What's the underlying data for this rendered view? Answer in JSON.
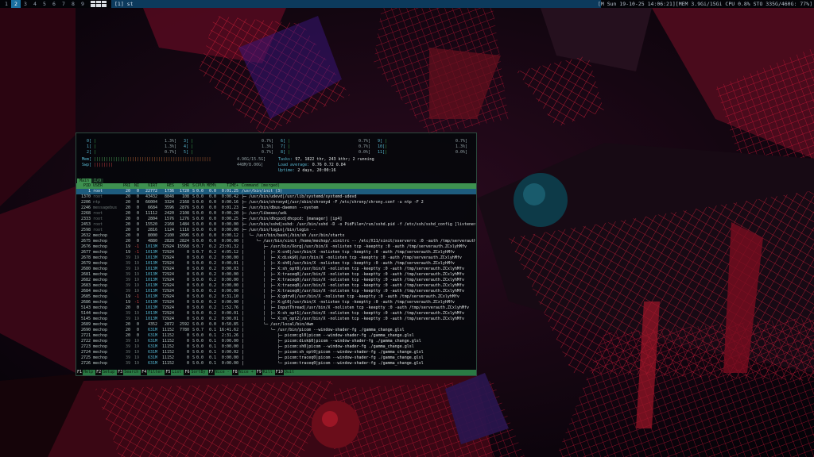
{
  "topbar": {
    "tags": [
      "1",
      "2",
      "3",
      "4",
      "5",
      "6",
      "7",
      "8",
      "9"
    ],
    "selected_tag": "2",
    "window_title": "[1] st",
    "status": "[M Sun 19-10-25 14:06:21][MEM 3.9Gi/15Gi CPU 0.8% STO 335G/460G: 77%]"
  },
  "htop": {
    "cpu_meters": [
      {
        "label": "0[",
        "value": "1.3%]"
      },
      {
        "label": "3[",
        "value": "0.7%]"
      },
      {
        "label": "6[",
        "value": "0.7%]"
      },
      {
        "label": "9[",
        "value": "0.7%]"
      },
      {
        "label": "1[",
        "value": "1.3%]"
      },
      {
        "label": "4[",
        "value": "1.3%]"
      },
      {
        "label": "7[",
        "value": "0.7%]"
      },
      {
        "label": "10[",
        "value": "1.3%]"
      },
      {
        "label": "2[",
        "value": "0.7%]"
      },
      {
        "label": "5[",
        "value": "0.7%]"
      },
      {
        "label": "8[",
        "value": "0.0%]"
      },
      {
        "label": "11[",
        "value": "0.0%]"
      }
    ],
    "mem": {
      "label": "Mem[",
      "value": "4.96G/15.5G]"
    },
    "swp": {
      "label": "Swp[",
      "value": "448M/8.00G]"
    },
    "tasks": {
      "prefix": "Tasks: ",
      "value": "97, 1822 thr, 243 kthr; 2 running"
    },
    "load": {
      "prefix": "Load average: ",
      "value": "0.76 0.72 0.84"
    },
    "uptime": {
      "prefix": "Uptime: ",
      "value": "2 days, 20:00:16"
    },
    "tabs": [
      "Main",
      "I/O"
    ],
    "columns": [
      "PID",
      "USER",
      "PRI",
      "NI",
      "VIRT",
      "RES",
      "SHR",
      "S",
      "CPU%",
      "MEM%",
      "TIME+",
      "Command (merged)"
    ],
    "processes": [
      [
        "1",
        "root",
        "20",
        "0",
        "22772",
        "1736",
        "1720",
        "S",
        "0.0",
        "0.0",
        "0:01.25",
        "/usr/bin/init (3)"
      ],
      [
        "1370",
        "root",
        "20",
        "0",
        "43432",
        "8848",
        "108",
        "S",
        "0.0",
        "0.0",
        "0:00.42",
        "├─ /usr/bin/udevd|/usr/lib/systemd/systemd-udevd"
      ],
      [
        "2206",
        "ntp",
        "20",
        "0",
        "66004",
        "3324",
        "2168",
        "S",
        "0.0",
        "0.0",
        "0:00.16",
        "├─ /usr/bin/chronyd|/usr/sbin/chronyd -F /etc/chrony/chrony.conf -u ntp -F 2"
      ],
      [
        "2246",
        "messagebus",
        "20",
        "0",
        "6684",
        "3596",
        "2876",
        "S",
        "0.0",
        "0.0",
        "0:01.23",
        "├─ /usr/bin/dbus-daemon --system"
      ],
      [
        "2268",
        "root",
        "20",
        "0",
        "11112",
        "2420",
        "2108",
        "S",
        "0.0",
        "0.0",
        "0:00.20",
        "├─ /usr/libexec/udi"
      ],
      [
        "2333",
        "root",
        "20",
        "0",
        "2804",
        "1576",
        "1276",
        "S",
        "0.0",
        "0.0",
        "0:00.25",
        "├─ /usr/bin/dhcpcd|dhcpcd: [manager] [ip4]"
      ],
      [
        "2453",
        "root",
        "20",
        "0",
        "15520",
        "2168",
        "1484",
        "S",
        "0.0",
        "0.0",
        "0:00.00",
        "├─ /usr/bin/sshd|sshd: /usr/bin/sshd -D -o PidFile=/run/sshd.pid -f /etc/ssh/sshd_config [listener]"
      ],
      [
        "2598",
        "root",
        "20",
        "0",
        "2816",
        "1124",
        "1116",
        "S",
        "0.0",
        "0.0",
        "0:00.00",
        "├─ /usr/bin/login|/bin/login --"
      ],
      [
        "2632",
        "mechop",
        "20",
        "0",
        "8000",
        "2100",
        "2096",
        "S",
        "0.0",
        "0.0",
        "0:00.12",
        "│  └─ /usr/bin/bash|/bin/sh /usr/bin/startx"
      ],
      [
        "2675",
        "mechop",
        "20",
        "0",
        "4880",
        "2828",
        "2824",
        "S",
        "0.0",
        "0.0",
        "0:00.00",
        "│     └─ /usr/bin/xinit /home/mechop/.xinitrc -- /etc/X11/xinit/xserverrc :0 -auth /tmp/serverauth"
      ],
      [
        "2676",
        "mechop",
        "19",
        "-1",
        "1013M",
        "72924",
        "15568",
        "S",
        "0.7",
        "0.2",
        "23:01.32",
        "│        ├─ /usr/bin/Xorg|/usr/bin/X -nolisten tcp -keeptty :0 -auth /tmp/serverauth.ZCxlyhMfv"
      ],
      [
        "2677",
        "mechop",
        "19",
        "-1",
        "1013M",
        "72924",
        "0",
        "S",
        "0.7",
        "0.2",
        "4:05.12",
        "│        │  ├─ X:cn0|/usr/bin/X -nolisten tcp -keeptty :0 -auth /tmp/serverauth.ZCxlyhMfv"
      ],
      [
        "2678",
        "mechop",
        "39",
        "19",
        "1013M",
        "72924",
        "0",
        "S",
        "0.0",
        "0.2",
        "0:00.00",
        "│        │  ├─ X:disk$0|/usr/bin/X -nolisten tcp -keeptty :0 -auth /tmp/serverauth.ZCxlyhMfv"
      ],
      [
        "2679",
        "mechop",
        "39",
        "19",
        "1013M",
        "72924",
        "0",
        "S",
        "0.0",
        "0.2",
        "0:00.01",
        "│        │  ├─ X:sh0|/usr/bin/X -nolisten tcp -keeptty :0 -auth /tmp/serverauth.ZCxlyhMfv"
      ],
      [
        "2680",
        "mechop",
        "39",
        "19",
        "1013M",
        "72924",
        "0",
        "S",
        "0.0",
        "0.2",
        "0:00.03",
        "│        │  ├─ X:sh_opt0|/usr/bin/X -nolisten tcp -keeptty :0 -auth /tmp/serverauth.ZCxlyhMfv"
      ],
      [
        "2681",
        "mechop",
        "39",
        "19",
        "1013M",
        "72924",
        "0",
        "S",
        "0.0",
        "0.2",
        "0:00.00",
        "│        │  ├─ X:traceq0|/usr/bin/X -nolisten tcp -keeptty :0 -auth /tmp/serverauth.ZCxlyhMfv"
      ],
      [
        "2682",
        "mechop",
        "39",
        "19",
        "1013M",
        "72924",
        "0",
        "S",
        "0.0",
        "0.2",
        "0:00.00",
        "│        │  ├─ X:traceq0|/usr/bin/X -nolisten tcp -keeptty :0 -auth /tmp/serverauth.ZCxlyhMfv"
      ],
      [
        "2683",
        "mechop",
        "39",
        "19",
        "1013M",
        "72924",
        "0",
        "S",
        "0.0",
        "0.2",
        "0:00.00",
        "│        │  ├─ X:traceq0|/usr/bin/X -nolisten tcp -keeptty :0 -auth /tmp/serverauth.ZCxlyhMfv"
      ],
      [
        "2684",
        "mechop",
        "39",
        "19",
        "1013M",
        "72924",
        "0",
        "S",
        "0.0",
        "0.2",
        "0:00.00",
        "│        │  ├─ X:traceq0|/usr/bin/X -nolisten tcp -keeptty :0 -auth /tmp/serverauth.ZCxlyhMfv"
      ],
      [
        "2685",
        "mechop",
        "19",
        "-1",
        "1013M",
        "72924",
        "0",
        "S",
        "0.0",
        "0.2",
        "0:31.10",
        "│        │  ├─ X:gdrv0|/usr/bin/X -nolisten tcp -keeptty :0 -auth /tmp/serverauth.ZCxlyhMfv"
      ],
      [
        "2686",
        "mechop",
        "19",
        "-1",
        "1013M",
        "72924",
        "0",
        "S",
        "0.0",
        "0.2",
        "0:00.00",
        "│        │  ├─ X:gl0|/usr/bin/X -nolisten tcp -keeptty :0 -auth /tmp/serverauth.ZCxlyhMfv"
      ],
      [
        "5143",
        "mechop",
        "20",
        "0",
        "1013M",
        "72924",
        "0",
        "S",
        "0.0",
        "0.2",
        "1:52.76",
        "│        │  ├─ InputThread|/usr/bin/X -nolisten tcp -keeptty :0 -auth /tmp/serverauth.ZCxlyhMfv"
      ],
      [
        "5144",
        "mechop",
        "39",
        "19",
        "1013M",
        "72924",
        "0",
        "S",
        "0.0",
        "0.2",
        "0:00.01",
        "│        │  ├─ X:sh_opt1|/usr/bin/X -nolisten tcp -keeptty :0 -auth /tmp/serverauth.ZCxlyhMfv"
      ],
      [
        "5145",
        "mechop",
        "39",
        "19",
        "1013M",
        "72924",
        "0",
        "S",
        "0.0",
        "0.2",
        "0:00.01",
        "│        │  └─ X:sh_opt2|/usr/bin/X -nolisten tcp -keeptty :0 -auth /tmp/serverauth.ZCxlyhMfv"
      ],
      [
        "2689",
        "mechop",
        "20",
        "0",
        "4352",
        "2872",
        "2592",
        "S",
        "0.0",
        "0.0",
        "0:50.85",
        "│        └─ /usr/local/bin/dwm"
      ],
      [
        "2690",
        "mechop",
        "20",
        "0",
        "631M",
        "11152",
        "7780",
        "S",
        "0.7",
        "0.1",
        "16:41.62",
        "│           └─ /usr/bin/picom --window-shader-fg ./gamma_change.glsl"
      ],
      [
        "2721",
        "mechop",
        "20",
        "0",
        "631M",
        "11152",
        "0",
        "S",
        "0.0",
        "0.1",
        "2:31.26",
        "│              ├─ picom:gl0|picom --window-shader-fg ./gamma_change.glsl"
      ],
      [
        "2722",
        "mechop",
        "39",
        "19",
        "631M",
        "11152",
        "0",
        "S",
        "0.0",
        "0.1",
        "0:00.00",
        "│              ├─ picom:disk$0|picom --window-shader-fg ./gamma_change.glsl"
      ],
      [
        "2723",
        "mechop",
        "39",
        "19",
        "631M",
        "11152",
        "0",
        "S",
        "0.0",
        "0.1",
        "0:00.00",
        "│              ├─ picom:sh0|picom --window-shader-fg ./gamma_change.glsl"
      ],
      [
        "2724",
        "mechop",
        "39",
        "19",
        "631M",
        "11152",
        "0",
        "S",
        "0.0",
        "0.1",
        "0:00.02",
        "│              ├─ picom:sh_opt0|picom --window-shader-fg ./gamma_change.glsl"
      ],
      [
        "2725",
        "mechop",
        "39",
        "19",
        "631M",
        "11152",
        "0",
        "S",
        "0.0",
        "0.1",
        "0:00.00",
        "│              ├─ picom:traceq0|picom --window-shader-fg ./gamma_change.glsl"
      ],
      [
        "2726",
        "mechop",
        "39",
        "19",
        "631M",
        "11152",
        "0",
        "S",
        "0.0",
        "0.1",
        "0:00.00",
        "│              └─ picom:traceq0|picom --window-shader-fg ./gamma_change.glsl"
      ]
    ],
    "fkeys": [
      {
        "key": "F1",
        "label": "Help"
      },
      {
        "key": "F2",
        "label": "Setup"
      },
      {
        "key": "F3",
        "label": "Search"
      },
      {
        "key": "F4",
        "label": "Filter"
      },
      {
        "key": "F5",
        "label": "List"
      },
      {
        "key": "F6",
        "label": "SortBy"
      },
      {
        "key": "F7",
        "label": "Nice -"
      },
      {
        "key": "F8",
        "label": "Nice +"
      },
      {
        "key": "F9",
        "label": "Kill"
      },
      {
        "key": "F10",
        "label": "Quit"
      }
    ]
  }
}
